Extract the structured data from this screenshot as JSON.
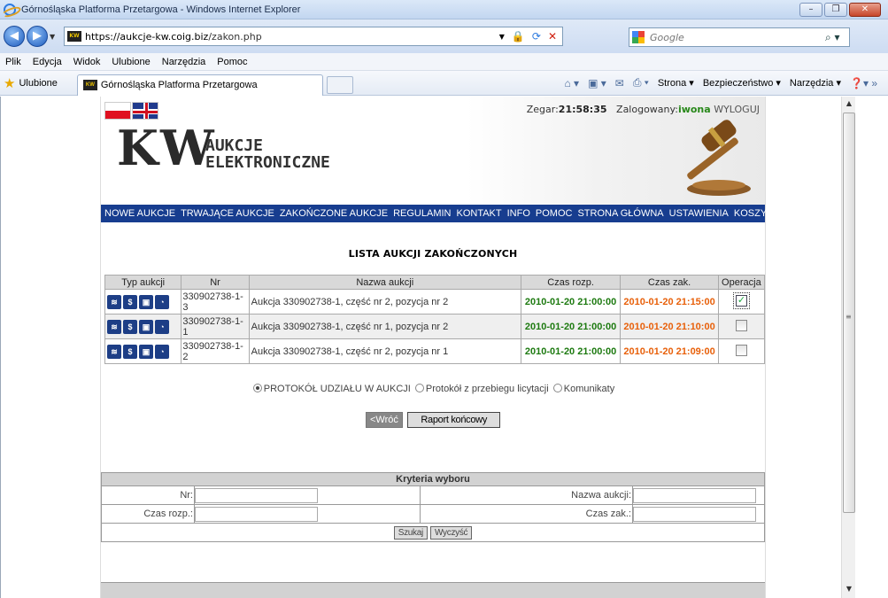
{
  "browser": {
    "window_title": "Górnośląska Platforma Przetargowa - Windows Internet Explorer",
    "url_host": "https://aukcje-kw.coig.biz",
    "url_path": "/zakon.php",
    "search_placeholder": "Google",
    "menu": [
      "Plik",
      "Edycja",
      "Widok",
      "Ulubione",
      "Narzędzia",
      "Pomoc"
    ],
    "favorites_label": "Ulubione",
    "tab_title": "Górnośląska Platforma Przetargowa",
    "cmd_strona": "Strona",
    "cmd_bezpieczenstwo": "Bezpieczeństwo",
    "cmd_narzedzia": "Narzędzia"
  },
  "header": {
    "logo_kw": "KW",
    "logo_line1": "AUKCJE",
    "logo_line2": "ELEKTRONICZNE",
    "clock_label": "Zegar:",
    "clock_time": "21:58:35",
    "logged_label": "Zalogowany:",
    "username": "iwona",
    "logout": "WYLOGUJ"
  },
  "nav": [
    "NOWE AUKCJE",
    "TRWAJĄCE AUKCJE",
    "ZAKOŃCZONE AUKCJE",
    "REGULAMIN",
    "KONTAKT",
    "INFO",
    "POMOC",
    "STRONA GŁÓWNA",
    "USTAWIENIA",
    "KOSZYK"
  ],
  "list": {
    "title": "LISTA AUKCJI ZAKOŃCZONYCH",
    "columns": [
      "Typ aukcji",
      "Nr",
      "Nazwa aukcji",
      "Czas rozp.",
      "Czas zak.",
      "Operacja"
    ],
    "rows": [
      {
        "nr": "330902738-1-3",
        "name": "Aukcja 330902738-1, część nr 2, pozycja nr 2",
        "start": "2010-01-20 21:00:00",
        "end": "2010-01-20 21:15:00",
        "checked": true
      },
      {
        "nr": "330902738-1-1",
        "name": "Aukcja 330902738-1, część nr 1, pozycja nr 2",
        "start": "2010-01-20 21:00:00",
        "end": "2010-01-20 21:10:00",
        "checked": false
      },
      {
        "nr": "330902738-1-2",
        "name": "Aukcja 330902738-1, część nr 2, pozycja nr 1",
        "start": "2010-01-20 21:00:00",
        "end": "2010-01-20 21:09:00",
        "checked": false
      }
    ]
  },
  "options": {
    "opt1": "PROTOKÓŁ UDZIAŁU W AUKCJI",
    "opt2": "Protokół z przebiegu licytacji",
    "opt3": "Komunikaty"
  },
  "buttons": {
    "back": "<Wróć",
    "report": "Raport końcowy"
  },
  "criteria": {
    "title": "Kryteria wyboru",
    "nr_label": "Nr:",
    "name_label": "Nazwa aukcji:",
    "start_label": "Czas rozp.:",
    "end_label": "Czas zak.:",
    "search": "Szukaj",
    "clear": "Wyczyść"
  }
}
